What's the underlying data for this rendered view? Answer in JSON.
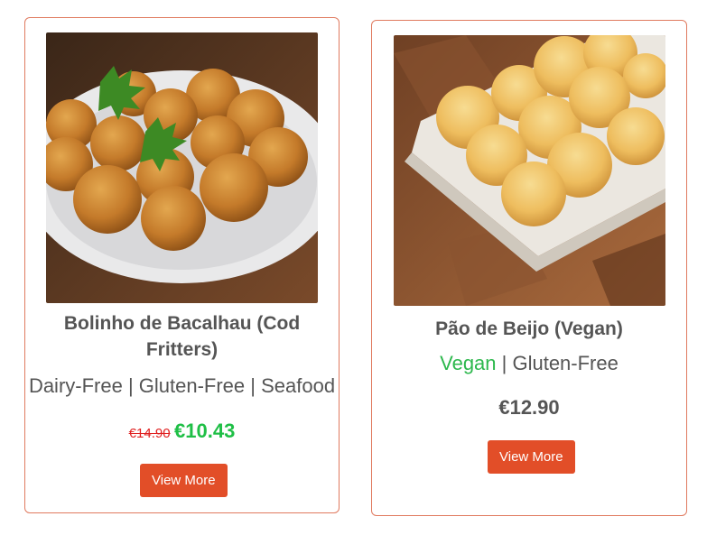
{
  "products": [
    {
      "title": "Bolinho de Bacalhau (Cod Fritters)",
      "tags": "Dairy-Free | Gluten-Free | Seafood",
      "old_price": "€14.90",
      "new_price": "€10.43",
      "button_label": "View More"
    },
    {
      "title": "Pão de Beijo (Vegan)",
      "tag_vegan": "Vegan",
      "tags_rest": " | Gluten-Free",
      "price": "€12.90",
      "button_label": "View More"
    }
  ],
  "colors": {
    "accent_button": "#e24e28",
    "card_border": "#e07a5f",
    "sale_price": "#1fbf46",
    "old_price": "#e02020",
    "vegan_tag": "#2db84d"
  }
}
